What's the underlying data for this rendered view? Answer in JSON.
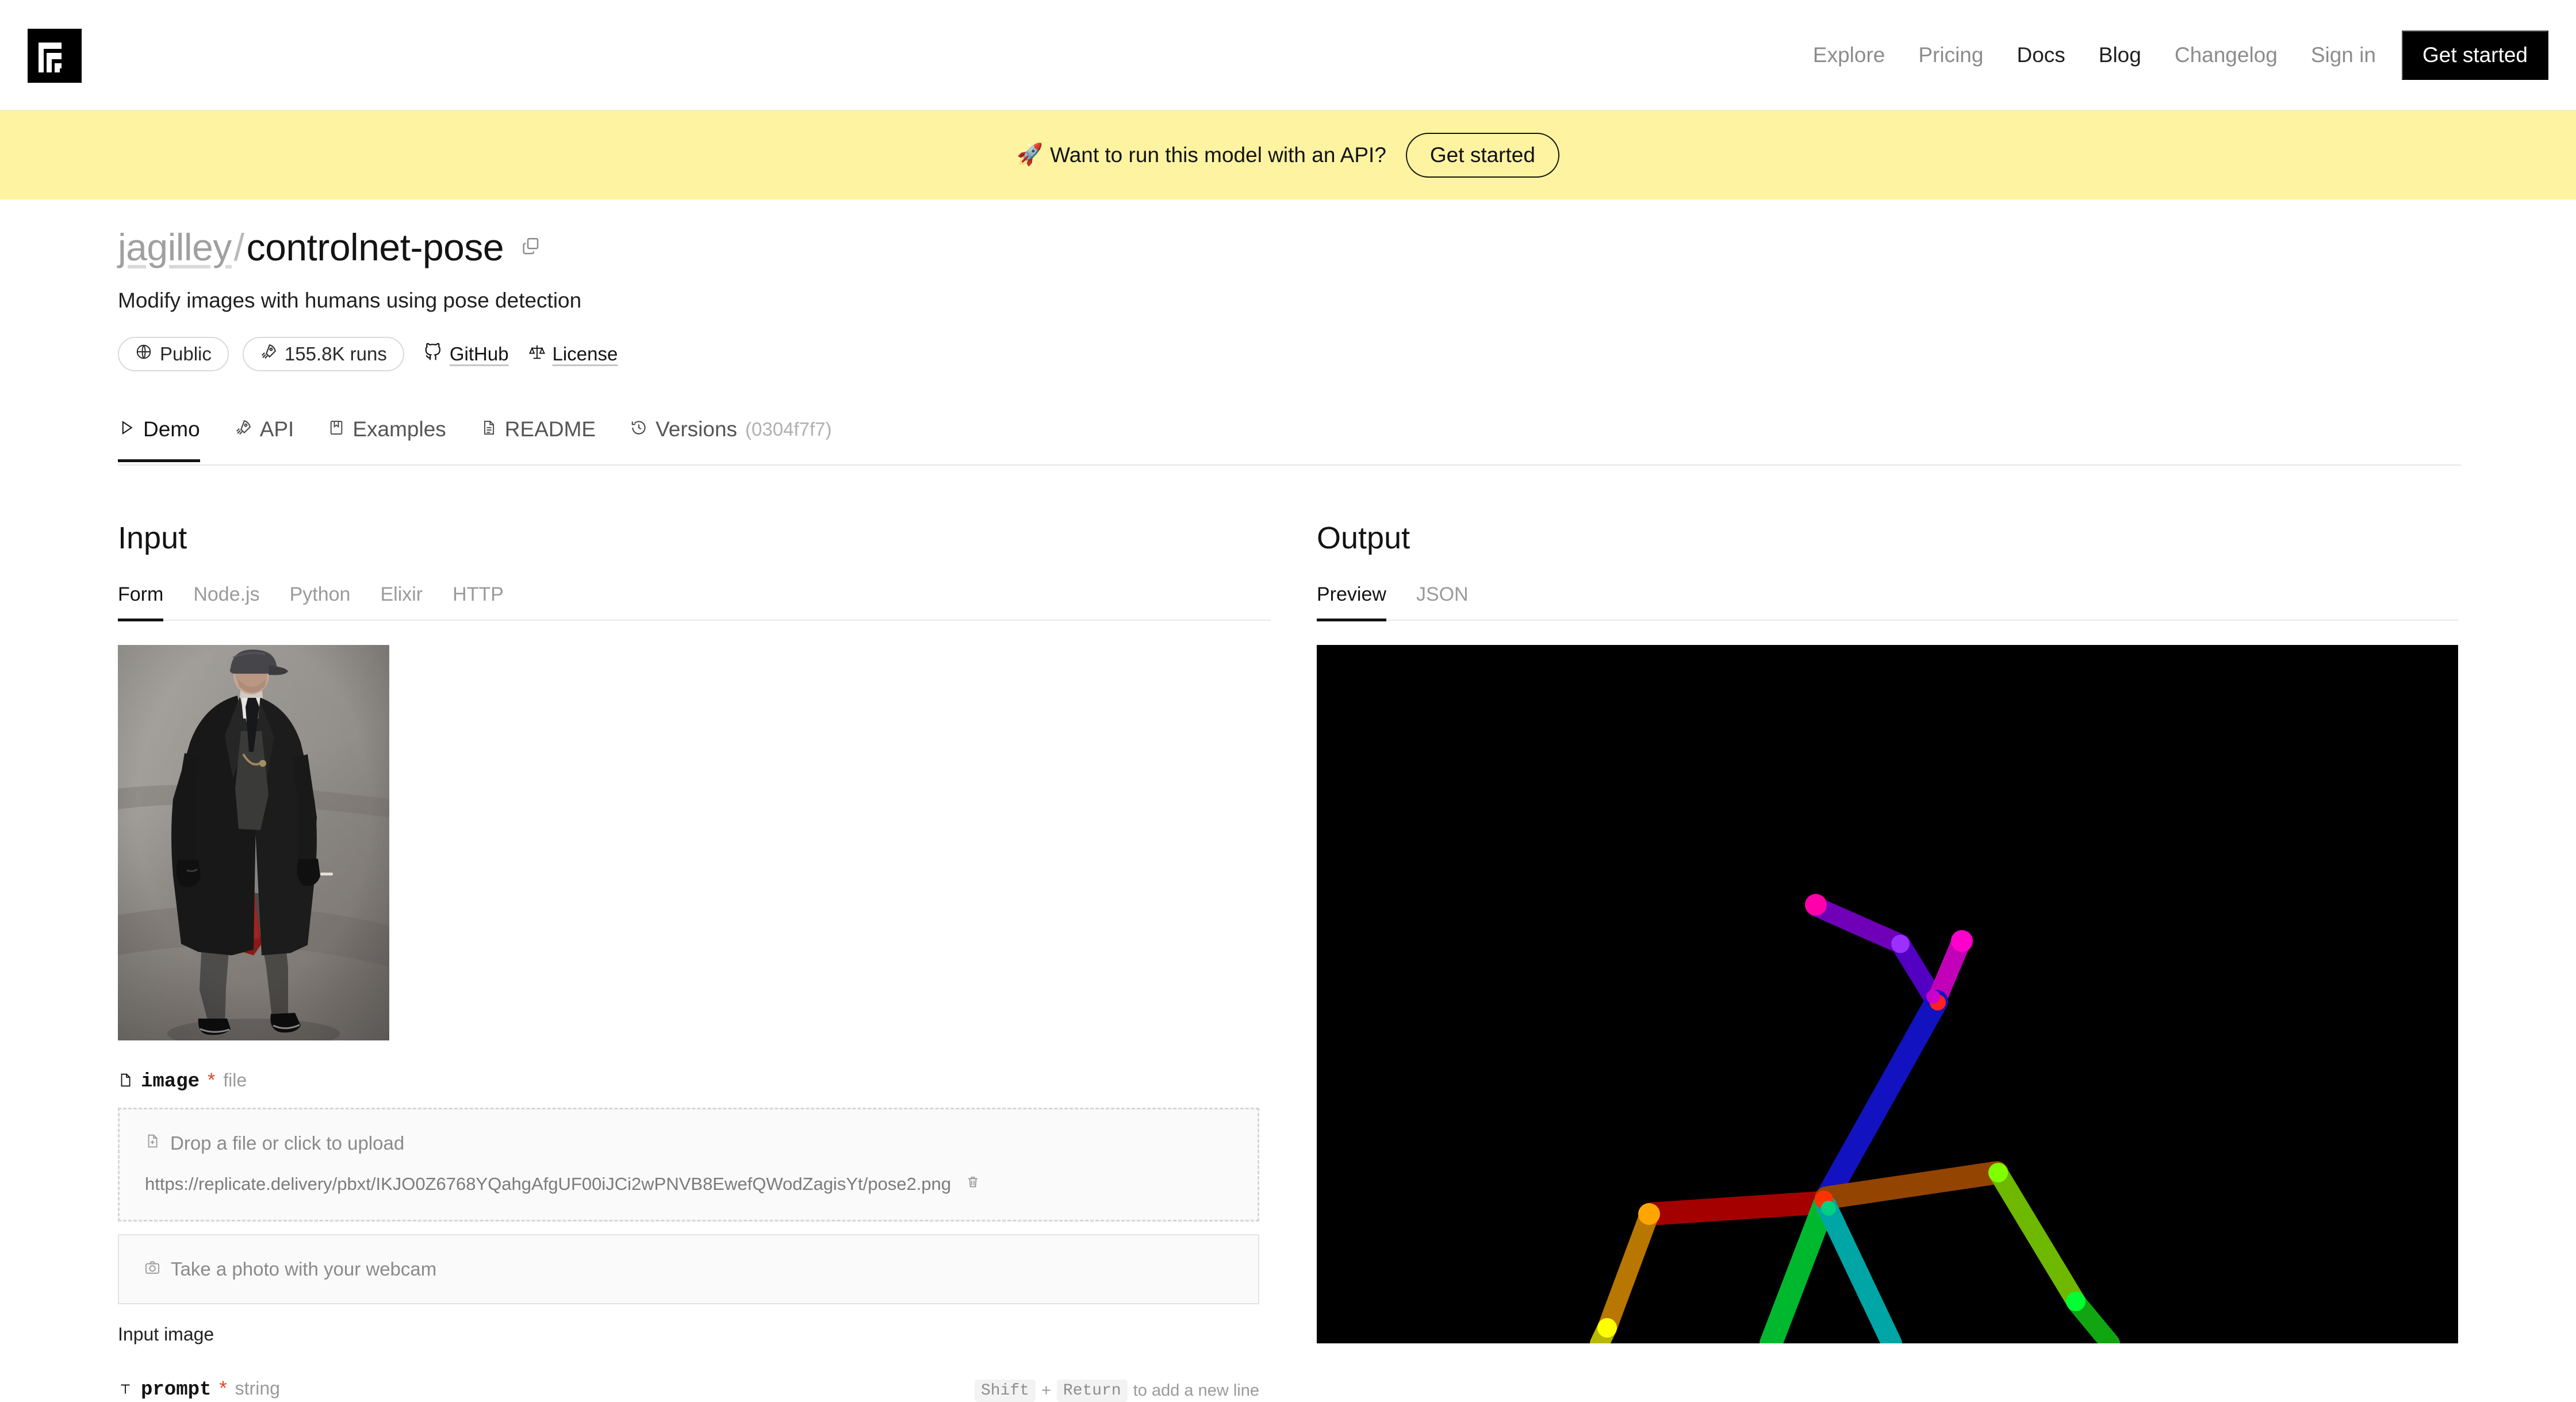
{
  "nav": {
    "logo_icon": "replicate-logo-icon",
    "links": [
      {
        "label": "Explore",
        "muted": true
      },
      {
        "label": "Pricing",
        "muted": true
      },
      {
        "label": "Docs",
        "muted": false
      },
      {
        "label": "Blog",
        "muted": false
      },
      {
        "label": "Changelog",
        "muted": true
      },
      {
        "label": "Sign in",
        "muted": true
      }
    ],
    "cta_label": "Get started"
  },
  "banner": {
    "icon": "rocket-icon",
    "emoji": "🚀",
    "text": "Want to run this model with an API?",
    "button_label": "Get started",
    "background": "#fef3a0"
  },
  "model": {
    "owner": "jagilley",
    "separator": "/",
    "name": "controlnet-pose",
    "copy_icon": "copy-icon",
    "description": "Modify images with humans using pose detection",
    "visibility": {
      "icon": "globe-icon",
      "label": "Public"
    },
    "runs": {
      "icon": "rocket-icon",
      "label": "155.8K runs"
    },
    "github": {
      "icon": "github-icon",
      "label": "GitHub"
    },
    "license": {
      "icon": "scales-icon",
      "label": "License"
    }
  },
  "tabs": [
    {
      "label": "Demo",
      "icon": "play-icon",
      "active": true,
      "hash": ""
    },
    {
      "label": "API",
      "icon": "rocket-icon",
      "active": false,
      "hash": ""
    },
    {
      "label": "Examples",
      "icon": "book-icon",
      "active": false,
      "hash": ""
    },
    {
      "label": "README",
      "icon": "document-icon",
      "active": false,
      "hash": ""
    },
    {
      "label": "Versions",
      "icon": "history-icon",
      "active": false,
      "hash": "(0304f7f7)"
    }
  ],
  "input": {
    "title": "Input",
    "subtabs": [
      {
        "label": "Form",
        "active": true
      },
      {
        "label": "Node.js",
        "active": false
      },
      {
        "label": "Python",
        "active": false
      },
      {
        "label": "Elixir",
        "active": false
      },
      {
        "label": "HTTP",
        "active": false
      }
    ],
    "preview_image_alt": "man in long dark coat and flat cap standing on a misty road",
    "image_field": {
      "icon": "file-icon",
      "name": "image",
      "required_marker": "*",
      "type": "file",
      "dropzone_icon": "file-upload-icon",
      "dropzone_label": "Drop a file or click to upload",
      "value": "https://replicate.delivery/pbxt/IKJO0Z6768YQahgAfgUF00iJCi2wPNVB8EwefQWodZagisYt/pose2.png",
      "delete_icon": "trash-icon",
      "webcam_icon": "camera-icon",
      "webcam_label": "Take a photo with your webcam",
      "helper_text": "Input image"
    },
    "prompt_field": {
      "icon": "text-icon",
      "name": "prompt",
      "required_marker": "*",
      "type": "string",
      "hint_key1": "Shift",
      "hint_plus": "+",
      "hint_key2": "Return",
      "hint_text": "to add a new line"
    }
  },
  "output": {
    "title": "Output",
    "subtabs": [
      {
        "label": "Preview",
        "active": true
      },
      {
        "label": "JSON",
        "active": false
      }
    ],
    "preview": {
      "type": "openpose-skeleton",
      "background": "#000000",
      "description": "OpenPose keypoint skeleton rendered on black background",
      "colors": {
        "head_magenta": "#ff00aa",
        "head_purple": "#8a00d4",
        "neck_blue": "#1414d2",
        "shoulder_red": "#b40000",
        "shoulder_brown": "#a04000",
        "left_arm_orange": "#c88000",
        "left_arm_yellow": "#c8c800",
        "right_arm_lime": "#6eb400",
        "right_arm_green": "#14b414",
        "hip_green": "#00c832",
        "hip_cyan": "#00b4b4",
        "joint_orange": "#ff8c00",
        "joint_green": "#00ff00",
        "joint_yellow": "#ffff00"
      }
    }
  }
}
